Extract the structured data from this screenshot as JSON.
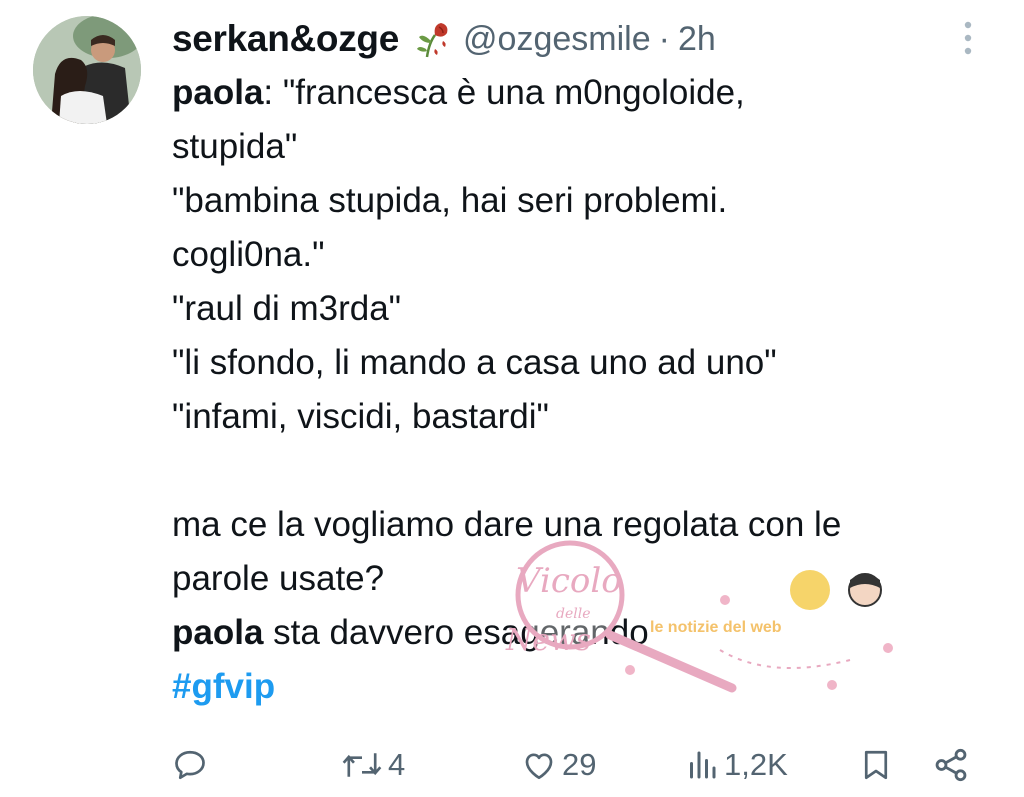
{
  "tweet": {
    "display_name": "serkan&ozge",
    "handle": "@ozgesmile",
    "separator": "·",
    "time": "2h",
    "body": {
      "l1_bold": "paola",
      "l1_rest": ": \"francesca è una m0ngoloide,",
      "l2": "stupida\"",
      "l3": "\"bambina stupida, hai seri problemi.",
      "l4": "cogli0na.\"",
      "l5": "\"raul di m3rda\"",
      "l6": "\"li sfondo, li mando a casa uno ad uno\"",
      "l7": "\"infami, viscidi, bastardi\"",
      "l8": "ma ce la vogliamo dare una regolata con le",
      "l9": "parole usate?",
      "l10_bold": "paola",
      "l10_rest": " sta davvero esagerando",
      "hashtag": "#gfvip"
    },
    "actions": {
      "reply_icon": "reply-icon",
      "retweet_icon": "retweet-icon",
      "retweets": "4",
      "like_icon": "heart-icon",
      "likes": "29",
      "views_icon": "views-icon",
      "views": "1,2K",
      "bookmark_icon": "bookmark-icon",
      "share_icon": "share-icon"
    }
  },
  "watermark": {
    "script_1": "Vicolo",
    "script_2": "delle",
    "script_3": "News",
    "ribbon": "le notizie del web"
  },
  "colors": {
    "text": "#0f1419",
    "secondary": "#536471",
    "hashtag": "#1d9bf0",
    "watermark_pink": "#e8a9c0"
  }
}
